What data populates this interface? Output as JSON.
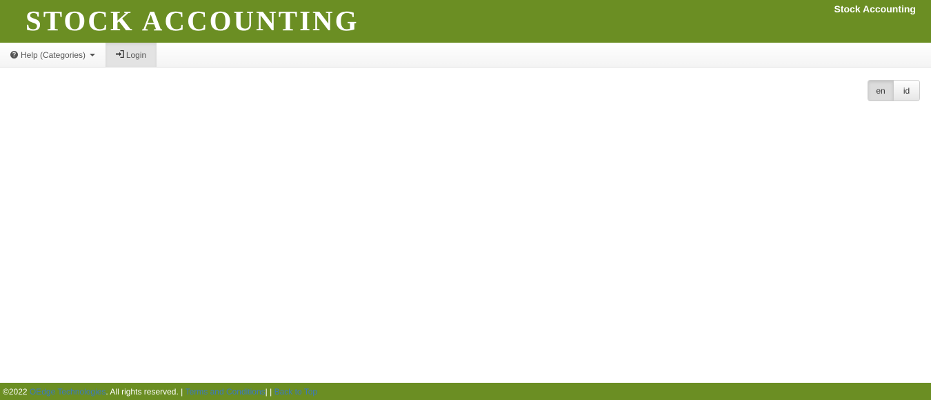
{
  "header": {
    "brand": "STOCK ACCOUNTING",
    "right_title": "Stock Accounting"
  },
  "nav": {
    "help_label": "Help (Categories)",
    "login_label": "Login"
  },
  "lang": {
    "en": "en",
    "id": "id",
    "active": "en"
  },
  "footer": {
    "copyright": "©2022",
    "company_link": "OEdge Technologies",
    "rights_text": ". All rights reserved. |",
    "terms_link": "Terms and Conditions",
    "separator": " | |",
    "back_to_top_link": "Back to Top"
  },
  "colors": {
    "header_bg": "#6b8e23",
    "link": "#3a78c2"
  }
}
